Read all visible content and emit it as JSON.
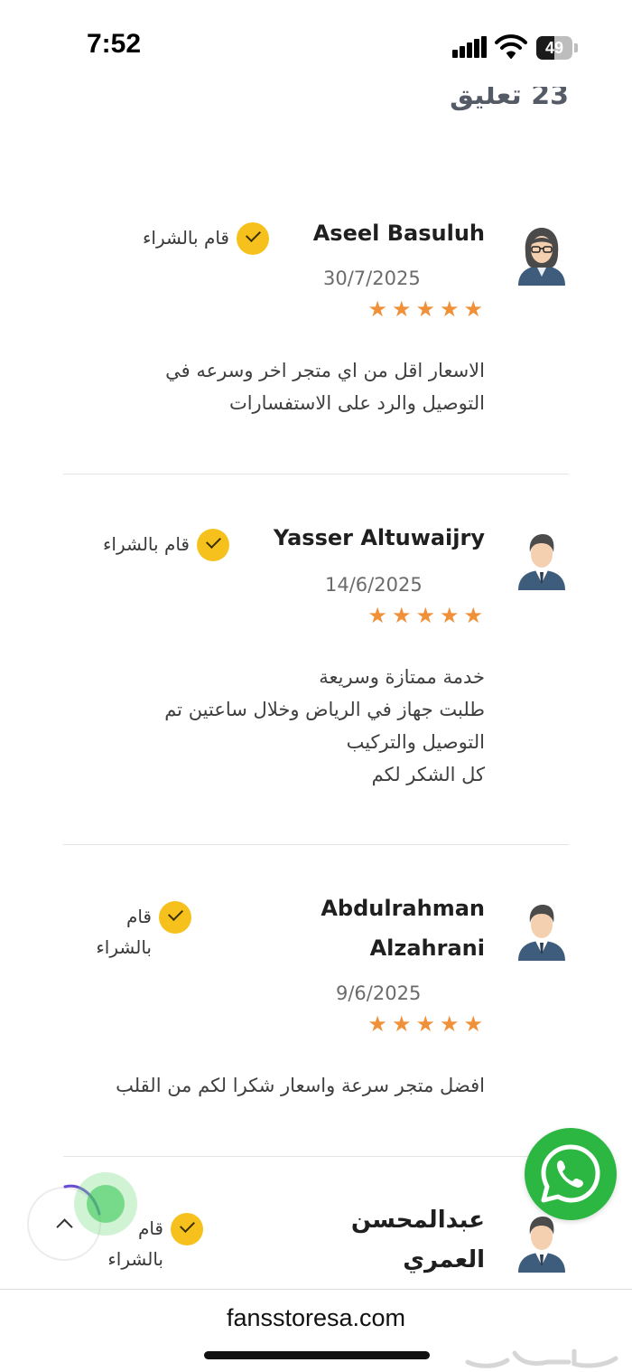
{
  "status_bar": {
    "time": "7:52",
    "battery_level": "49"
  },
  "section": {
    "comments_count": "23 تعليق"
  },
  "reviews": [
    {
      "name": "Aseel Basuluh",
      "date": "30/7/2025",
      "verified_label": "قام بالشراء",
      "rating": 5,
      "text": "الاسعار اقل من اي متجر اخر وسرعه في\nالتوصيل والرد على الاستفسارات",
      "avatar": "female-avatar-icon"
    },
    {
      "name": "Yasser Altuwaijry",
      "date": "14/6/2025",
      "verified_label": "قام بالشراء",
      "rating": 5,
      "text": "خدمة ممتازة وسريعة\nطلبت جهاز في الرياض وخلال ساعتين تم\nالتوصيل والتركيب\nكل الشكر لكم",
      "avatar": "male-avatar-icon"
    },
    {
      "name": "Abdulrahman Alzahrani",
      "date": "9/6/2025",
      "verified_label": "قام بالشراء",
      "rating": 5,
      "text": "افضل متجر سرعة واسعار شكرا لكم من القلب",
      "avatar": "male-avatar-icon"
    },
    {
      "name": "عبدالمحسن العمري",
      "verified_label": "قام بالشراء",
      "avatar": "male-avatar-icon"
    }
  ],
  "star_glyph": "★",
  "floating": {
    "whatsapp_icon": "whatsapp-icon",
    "scroll_top_icon": "chevron-up-icon"
  },
  "browser": {
    "url": "fansstoresa.com"
  },
  "watermark": {
    "text": "حراج"
  },
  "colors": {
    "verified_badge": "#f6c11c",
    "star": "#f0913a",
    "whatsapp": "#2cb742"
  }
}
